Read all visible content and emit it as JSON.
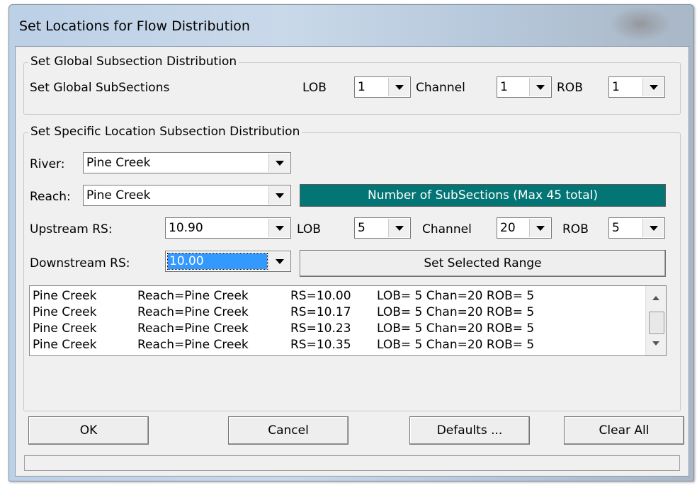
{
  "window": {
    "title": "Set Locations for Flow Distribution"
  },
  "global": {
    "group_title": "Set Global Subsection Distribution",
    "label": "Set Global SubSections",
    "lob_label": "LOB",
    "lob_value": "1",
    "channel_label": "Channel",
    "channel_value": "1",
    "rob_label": "ROB",
    "rob_value": "1"
  },
  "specific": {
    "group_title": "Set Specific Location Subsection Distribution",
    "river_label": "River:",
    "river_value": "Pine Creek",
    "reach_label": "Reach:",
    "reach_value": "Pine Creek",
    "banner": "Number of SubSections (Max 45 total)",
    "upstream_label": "Upstream RS:",
    "upstream_value": "10.90",
    "lob_label": "LOB",
    "lob_value": "5",
    "channel_label": "Channel",
    "channel_value": "20",
    "rob_label": "ROB",
    "rob_value": "5",
    "downstream_label": "Downstream RS:",
    "downstream_value": "10.00",
    "set_range_label": "Set Selected Range"
  },
  "list": {
    "rows": [
      {
        "river": "Pine Creek",
        "reach": "Reach=Pine Creek",
        "rs": "RS=10.00",
        "dist": "LOB= 5 Chan=20 ROB= 5"
      },
      {
        "river": "Pine Creek",
        "reach": "Reach=Pine Creek",
        "rs": "RS=10.17",
        "dist": "LOB= 5 Chan=20 ROB= 5"
      },
      {
        "river": "Pine Creek",
        "reach": "Reach=Pine Creek",
        "rs": "RS=10.23",
        "dist": "LOB= 5 Chan=20 ROB= 5"
      },
      {
        "river": "Pine Creek",
        "reach": "Reach=Pine Creek",
        "rs": "RS=10.35",
        "dist": "LOB= 5 Chan=20 ROB= 5"
      }
    ]
  },
  "buttons": {
    "ok": "OK",
    "cancel": "Cancel",
    "defaults": "Defaults ...",
    "clear_all": "Clear All"
  },
  "colors": {
    "banner_bg": "#037575",
    "selection": "#3399ff"
  }
}
